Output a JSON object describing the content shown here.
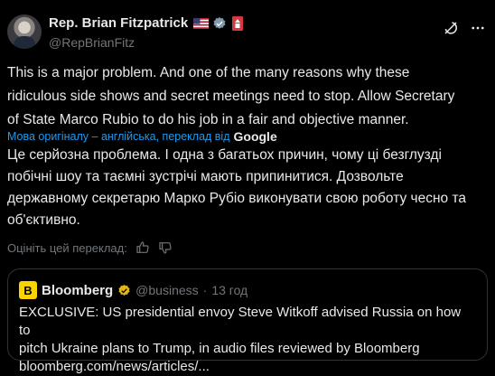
{
  "author": {
    "name": "Rep. Brian Fitzpatrick",
    "handle": "@RepBrianFitz"
  },
  "tweet": {
    "text": "This is a major problem. And one of the many reasons why these\nridiculous side shows and secret meetings need to stop.  Allow Secretary\nof State Marco Rubio to do his job in a fair and objective manner.",
    "translated_by_label": "Мова оригіналу – англійська, переклад від",
    "translated_by_brand": "Google",
    "translation": "Це серйозна проблема. І одна з багатьох причин, чому ці безглузді\nпобічні шоу та таємні зустрічі мають припинитися. Дозвольте\nдержавному секретарю Марко Рубіо виконувати свою роботу чесно та\nоб'єктивно.",
    "rate_label": "Оцініть цей переклад:"
  },
  "quote": {
    "logo_letter": "B",
    "name": "Bloomberg",
    "handle": "@business",
    "separator": "·",
    "time": "13 год",
    "text": "EXCLUSIVE: US presidential envoy Steve Witkoff advised Russia on how to\npitch Ukraine plans to Trump, in audio files reviewed by Bloomberg\nbloomberg.com/news/articles/..."
  },
  "colors": {
    "background": "#000000",
    "text": "#e7e9ea",
    "muted": "#71767b",
    "link": "#1d9bf0",
    "verified_blue": "#1d9bf0",
    "verified_gold": "#e2b719",
    "bloomberg_yellow": "#f9d400"
  },
  "icons": [
    "flag-usa-icon",
    "verified-gray-icon",
    "congress-badge-icon",
    "grok-icon",
    "more-icon",
    "thumbs-up-icon",
    "thumbs-down-icon",
    "verified-gold-icon"
  ]
}
